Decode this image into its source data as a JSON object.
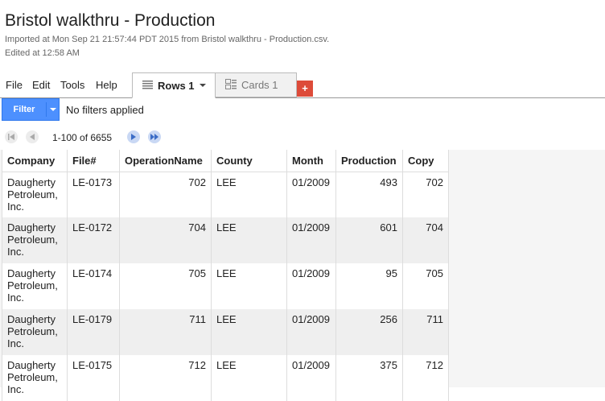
{
  "header": {
    "title": "Bristol walkthru - Production",
    "imported": "Imported at Mon Sep 21 21:57:44 PDT 2015 from Bristol walkthru - Production.csv.",
    "edited": "Edited at 12:58 AM"
  },
  "menu": [
    "File",
    "Edit",
    "Tools",
    "Help"
  ],
  "tabs": {
    "rows_label": "Rows 1",
    "cards_label": "Cards 1",
    "add_label": "+"
  },
  "filter": {
    "button_label": "Filter",
    "status": "No filters applied"
  },
  "pager": {
    "range": "1-100 of 6655"
  },
  "colors": {
    "filter_button": "#4d90fe",
    "add_tab": "#dd4b39",
    "alt_row": "#efefef"
  },
  "table": {
    "columns": [
      "Company",
      "File#",
      "OperationName",
      "County",
      "Month",
      "Production",
      "Copy"
    ],
    "rows": [
      [
        "Daugherty Petroleum, Inc.",
        "LE-0173",
        "702",
        "LEE",
        "01/2009",
        "493",
        "702"
      ],
      [
        "Daugherty Petroleum, Inc.",
        "LE-0172",
        "704",
        "LEE",
        "01/2009",
        "601",
        "704"
      ],
      [
        "Daugherty Petroleum, Inc.",
        "LE-0174",
        "705",
        "LEE",
        "01/2009",
        "95",
        "705"
      ],
      [
        "Daugherty Petroleum, Inc.",
        "LE-0179",
        "711",
        "LEE",
        "01/2009",
        "256",
        "711"
      ],
      [
        "Daugherty Petroleum, Inc.",
        "LE-0175",
        "712",
        "LEE",
        "01/2009",
        "375",
        "712"
      ]
    ]
  }
}
